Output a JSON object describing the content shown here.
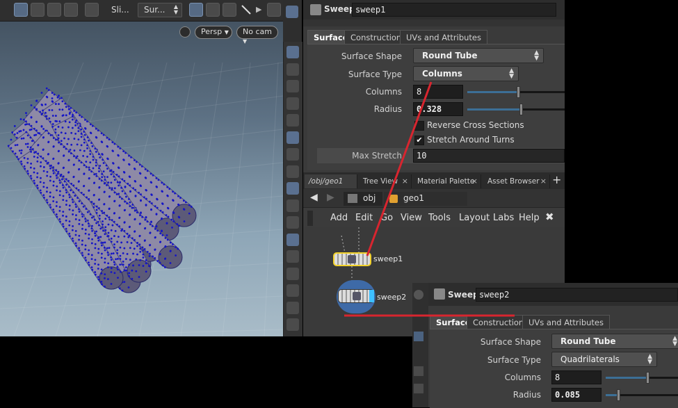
{
  "viewport": {
    "toolbar": {
      "slice_label": "Sli...",
      "surface_dropdown": "Sur...",
      "icons": [
        "view-cube-icon",
        "paint-icon",
        "particle-icon",
        "object-icon",
        "pin-icon",
        "select-box-icon",
        "lasso-icon",
        "hand-icon",
        "brush-icon",
        "play-icon",
        "transform-icon"
      ]
    },
    "view_buttons": {
      "projection": "Persp",
      "camera": "No cam"
    }
  },
  "shelf": {
    "icons": [
      "eye-icon",
      "shading-icon",
      "lock-icon",
      "scissors-icon",
      "camera-icon",
      "light-icon",
      "bulb-icon",
      "skull-icon",
      "snapshot-icon",
      "curve-icon",
      "brush-icon",
      "point-icon",
      "knife-icon",
      "pen-icon",
      "number-12-icon",
      "bucket-icon",
      "number-12-icon"
    ]
  },
  "params1": {
    "node_type": "Sweep",
    "node_name": "sweep1",
    "tabs": [
      "Surface",
      "Construction",
      "UVs and Attributes"
    ],
    "active_tab": "Surface",
    "surface_shape_label": "Surface Shape",
    "surface_shape_value": "Round Tube",
    "surface_type_label": "Surface Type",
    "surface_type_value": "Columns",
    "columns_label": "Columns",
    "columns_value": "8",
    "radius_label": "Radius",
    "radius_value": "0.328",
    "reverse_label": "Reverse Cross Sections",
    "reverse_checked": false,
    "stretch_label": "Stretch Around Turns",
    "stretch_checked": true,
    "max_stretch_label": "Max Stretch",
    "max_stretch_value": "10",
    "columns_slider": 0.52,
    "radius_slider": 0.55
  },
  "network": {
    "tabs": [
      "/obj/geo1",
      "Tree View",
      "Material Palette",
      "Asset Browser"
    ],
    "add_tab": "+",
    "close_glyph": "×",
    "path": {
      "root": "obj",
      "current": "geo1"
    },
    "menu": [
      "Add",
      "Edit",
      "Go",
      "View",
      "Tools",
      "Layout",
      "Labs",
      "Help"
    ],
    "nodes": [
      {
        "name": "sweep1"
      },
      {
        "name": "sweep2"
      }
    ]
  },
  "params2": {
    "node_type": "Sweep",
    "node_name": "sweep2",
    "tabs": [
      "Surface",
      "Construction",
      "UVs and Attributes"
    ],
    "active_tab": "Surface",
    "surface_shape_label": "Surface Shape",
    "surface_shape_value": "Round Tube",
    "surface_type_label": "Surface Type",
    "surface_type_value": "Quadrilaterals",
    "columns_label": "Columns",
    "columns_value": "8",
    "radius_label": "Radius",
    "radius_value": "0.085",
    "columns_slider": 0.58,
    "radius_slider": 0.17
  },
  "colors": {
    "point_blue": "#1414c8",
    "annotation_red": "#d8252f",
    "selected_node": "#f3d22b",
    "slider_fill": "#3c6f96"
  }
}
